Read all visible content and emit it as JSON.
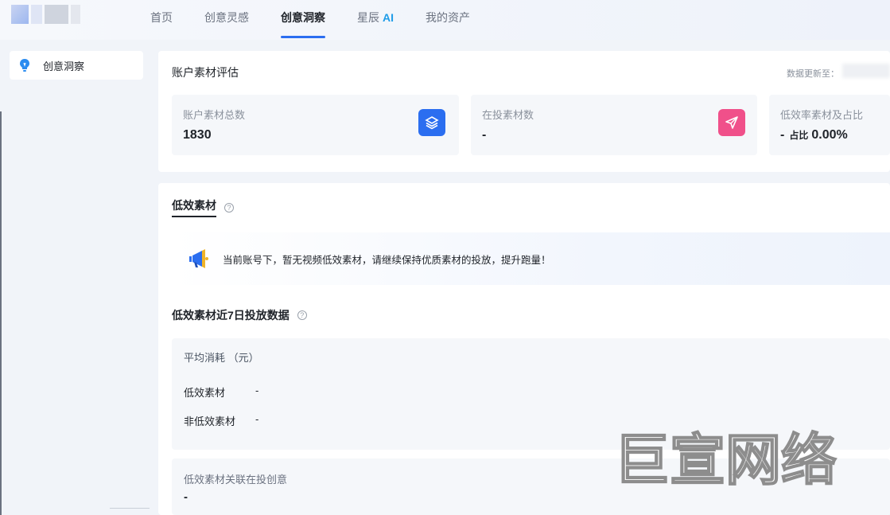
{
  "nav": {
    "items": [
      {
        "label": "首页"
      },
      {
        "label": "创意灵感"
      },
      {
        "label": "创意洞察"
      },
      {
        "label": "星辰"
      },
      {
        "label": "我的资产"
      }
    ],
    "ai_tag": "AI",
    "active_index": 2
  },
  "sidebar": {
    "items": [
      {
        "label": "创意洞察",
        "icon": "lightbulb-icon"
      }
    ]
  },
  "overview": {
    "title": "账户素材评估",
    "update_label": "数据更新至：",
    "cards": [
      {
        "label": "账户素材总数",
        "value": "1830",
        "icon": "layers-icon",
        "icon_color": "#2b6ef0"
      },
      {
        "label": "在投素材数",
        "value": "-",
        "icon": "send-icon",
        "icon_color": "#f0508a"
      },
      {
        "label": "低效率素材及占比",
        "value": "-",
        "ratio_label": "占比",
        "ratio_value": "0.00%"
      }
    ]
  },
  "low_efficiency": {
    "title": "低效素材",
    "notice": "当前账号下，暂无视频低效素材，请继续保持优质素材的投放，提升跑量！"
  },
  "recent": {
    "title": "低效素材近7日投放数据",
    "avg_cost_header": "平均消耗 （元）",
    "rows": [
      {
        "label": "低效素材",
        "value": "-"
      },
      {
        "label": "非低效素材",
        "value": "-"
      }
    ],
    "linked_header": "低效素材关联在投创意",
    "linked_value": "-"
  },
  "watermark": "巨宣网络",
  "colors": {
    "accent": "#2b6ef0",
    "ai": "#1e9ce8",
    "pink": "#f0508a"
  }
}
